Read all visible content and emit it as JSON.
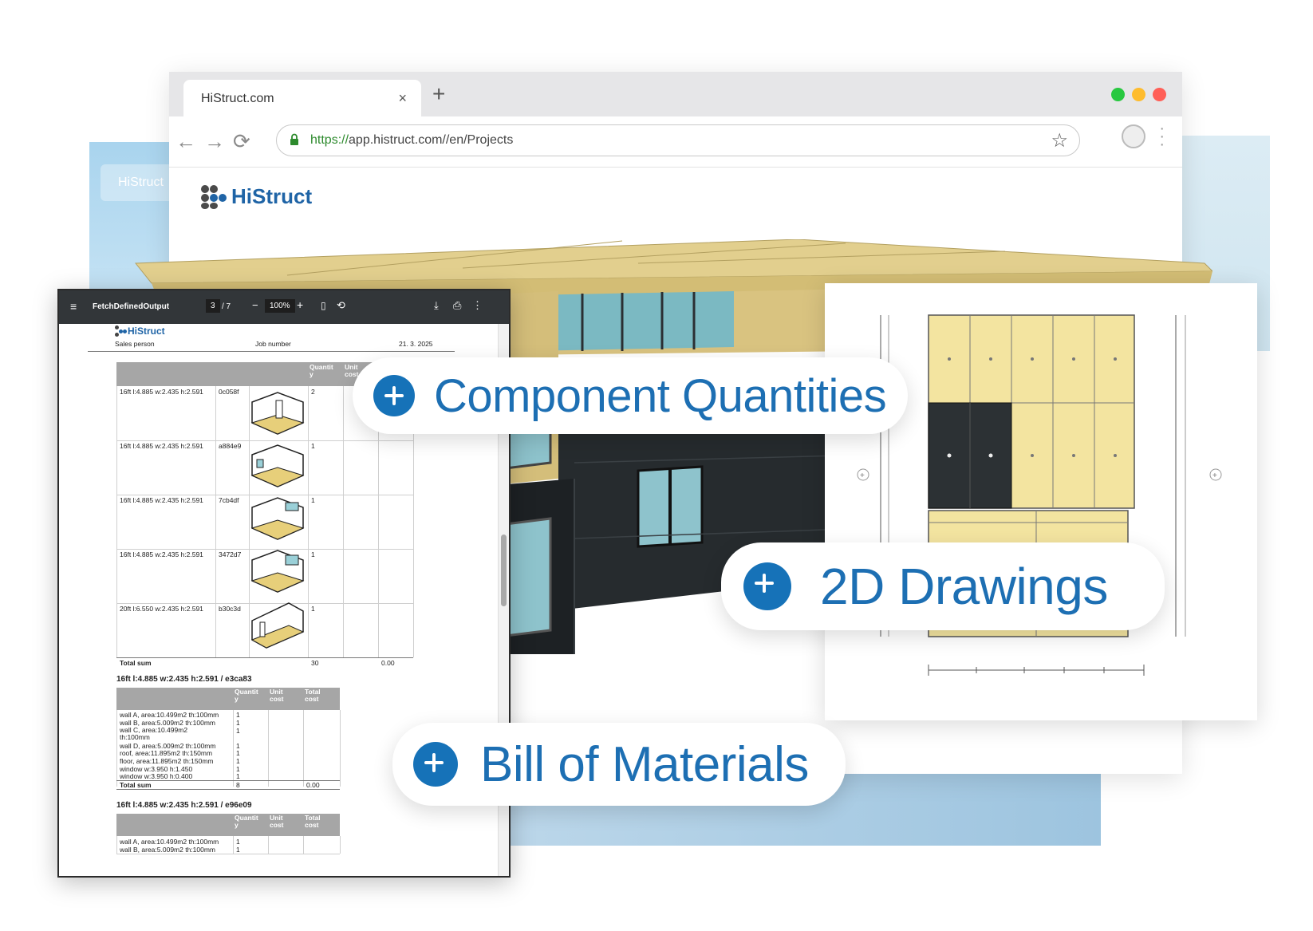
{
  "browser": {
    "tab_title": "HiStruct.com",
    "url_scheme": "https://",
    "url_rest": "app.histruct.com//en/Projects",
    "colors": {
      "close": "#ff5f57",
      "minimize": "#febc2e",
      "maximize": "#28c840"
    }
  },
  "background_tab_label": "HiStruct",
  "brand": {
    "name": "HiStruct",
    "color": "#1f64a6"
  },
  "pdf": {
    "toolbar": {
      "title": "FetchDefinedOutput",
      "page_current": "3",
      "page_total": "/ 7",
      "zoom": "100%"
    },
    "header": {
      "brand": "HiStruct",
      "sales_person": "Sales person",
      "job_number": "Job number",
      "date": "21. 3. 2025"
    },
    "table1": {
      "col_quantity": "Quantit\ny",
      "col_unit": "Unit\ncost",
      "rows": [
        {
          "name": "16ft l:4.885 w:2.435 h:2.591",
          "code": "0c058f",
          "qty": "2"
        },
        {
          "name": "16ft l:4.885 w:2.435 h:2.591",
          "code": "a884e9",
          "qty": "1"
        },
        {
          "name": "16ft l:4.885 w:2.435 h:2.591",
          "code": "7cb4df",
          "qty": "1"
        },
        {
          "name": "16ft l:4.885 w:2.435 h:2.591",
          "code": "3472d7",
          "qty": "1"
        },
        {
          "name": "20ft l:6.550 w:2.435 h:2.591",
          "code": "b30c3d",
          "qty": "1"
        }
      ],
      "total_label": "Total sum",
      "total_qty": "30",
      "total_cost": "0.00"
    },
    "table2": {
      "title": "16ft l:4.885 w:2.435 h:2.591 / e3ca83",
      "col_quantity": "Quantit\ny",
      "col_unit": "Unit\ncost",
      "col_total": "Total\ncost",
      "rows": [
        {
          "name": "wall A, area:10.499m2 th:100mm",
          "qty": "1"
        },
        {
          "name": "wall B, area:5.009m2 th:100mm",
          "qty": "1"
        },
        {
          "name": "wall C, area:10.499m2\nth:100mm",
          "qty": "1"
        },
        {
          "name": "wall D, area:5.009m2 th:100mm",
          "qty": "1"
        },
        {
          "name": "roof, area:11.895m2 th:150mm",
          "qty": "1"
        },
        {
          "name": "floor, area:11.895m2 th:150mm",
          "qty": "1"
        },
        {
          "name": "window w:3.950 h:1.450",
          "qty": "1"
        },
        {
          "name": "window w:3.950 h:0.400",
          "qty": "1"
        }
      ],
      "total_label": "Total sum",
      "total_qty": "8",
      "total_cost": "0.00"
    },
    "table3": {
      "title": "16ft l:4.885 w:2.435 h:2.591 / e96e09",
      "col_quantity": "Quantit\ny",
      "col_unit": "Unit\ncost",
      "col_total": "Total\ncost",
      "rows": [
        {
          "name": "wall A, area:10.499m2 th:100mm",
          "qty": "1"
        },
        {
          "name": "wall B, area:5.009m2 th:100mm",
          "qty": "1"
        }
      ]
    }
  },
  "callouts": {
    "component_quantities": "Component Quantities",
    "drawings_2d": "2D Drawings",
    "bill_of_materials": "Bill of Materials",
    "accent": "#1672b8"
  },
  "icons": [
    "back-arrow-icon",
    "forward-arrow-icon",
    "reload-icon",
    "lock-icon",
    "star-icon",
    "profile-icon",
    "menu-icon",
    "plus-icon",
    "download-icon",
    "print-icon",
    "rotate-icon",
    "fit-page-icon"
  ]
}
